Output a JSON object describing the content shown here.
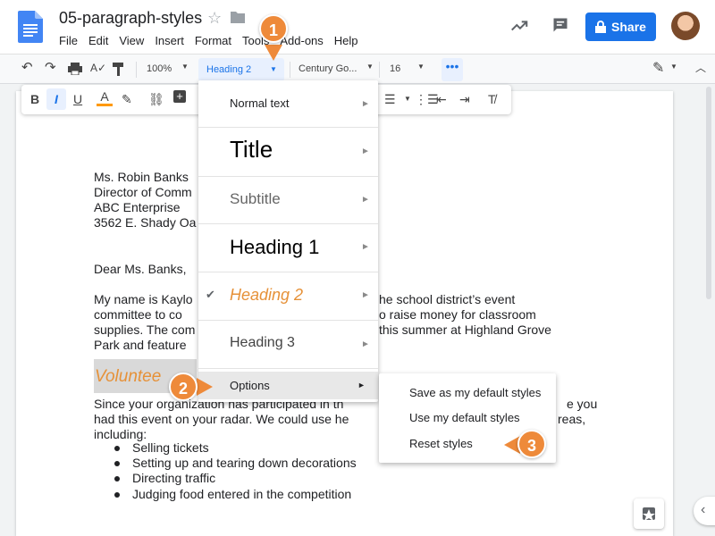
{
  "header": {
    "doc_title": "05-paragraph-styles",
    "menus": [
      "File",
      "Edit",
      "View",
      "Insert",
      "Format",
      "Tools",
      "Add-ons",
      "Help"
    ],
    "share_label": "Share"
  },
  "toolbar": {
    "zoom": "100%",
    "style": "Heading 2",
    "font": "Century Go...",
    "font_size": "16",
    "more": "•••"
  },
  "document": {
    "address": [
      "Ms. Robin Banks",
      "Director of Comm",
      "ABC Enterprise",
      "3562 E. Shady Oa"
    ],
    "greeting": "Dear Ms. Banks,",
    "para_left": [
      "My name is Kaylo",
      "committee to co",
      "supplies. The com",
      "Park and feature"
    ],
    "para_right": [
      "he school district’s event",
      "o raise money for classroom",
      "this summer at Highland Grove",
      ""
    ],
    "volunteer_heading": "Voluntee",
    "para2_line1_left": "Since your organization has participated in th",
    "para2_line1_right": "e you",
    "para2_line2_left": "had this event on your radar. We could use he",
    "para2_line2_right": "reas,",
    "para2_line3": "including:",
    "bullets": [
      "Selling tickets",
      "Setting up and tearing down decorations",
      "Directing traffic",
      "Judging food entered in the competition"
    ]
  },
  "style_menu": {
    "items": [
      {
        "label": "Normal text"
      },
      {
        "label": "Title"
      },
      {
        "label": "Subtitle"
      },
      {
        "label": "Heading 1"
      },
      {
        "label": "Heading 2",
        "checked": true
      },
      {
        "label": "Heading 3"
      },
      {
        "label": "Options"
      }
    ]
  },
  "options_submenu": {
    "items": [
      "Save as my default styles",
      "Use my default styles",
      "Reset styles"
    ]
  },
  "callouts": [
    "1",
    "2",
    "3"
  ],
  "colors": {
    "accent": "#1a73e8",
    "callout": "#ee8a3a",
    "heading2": "#e69138"
  }
}
